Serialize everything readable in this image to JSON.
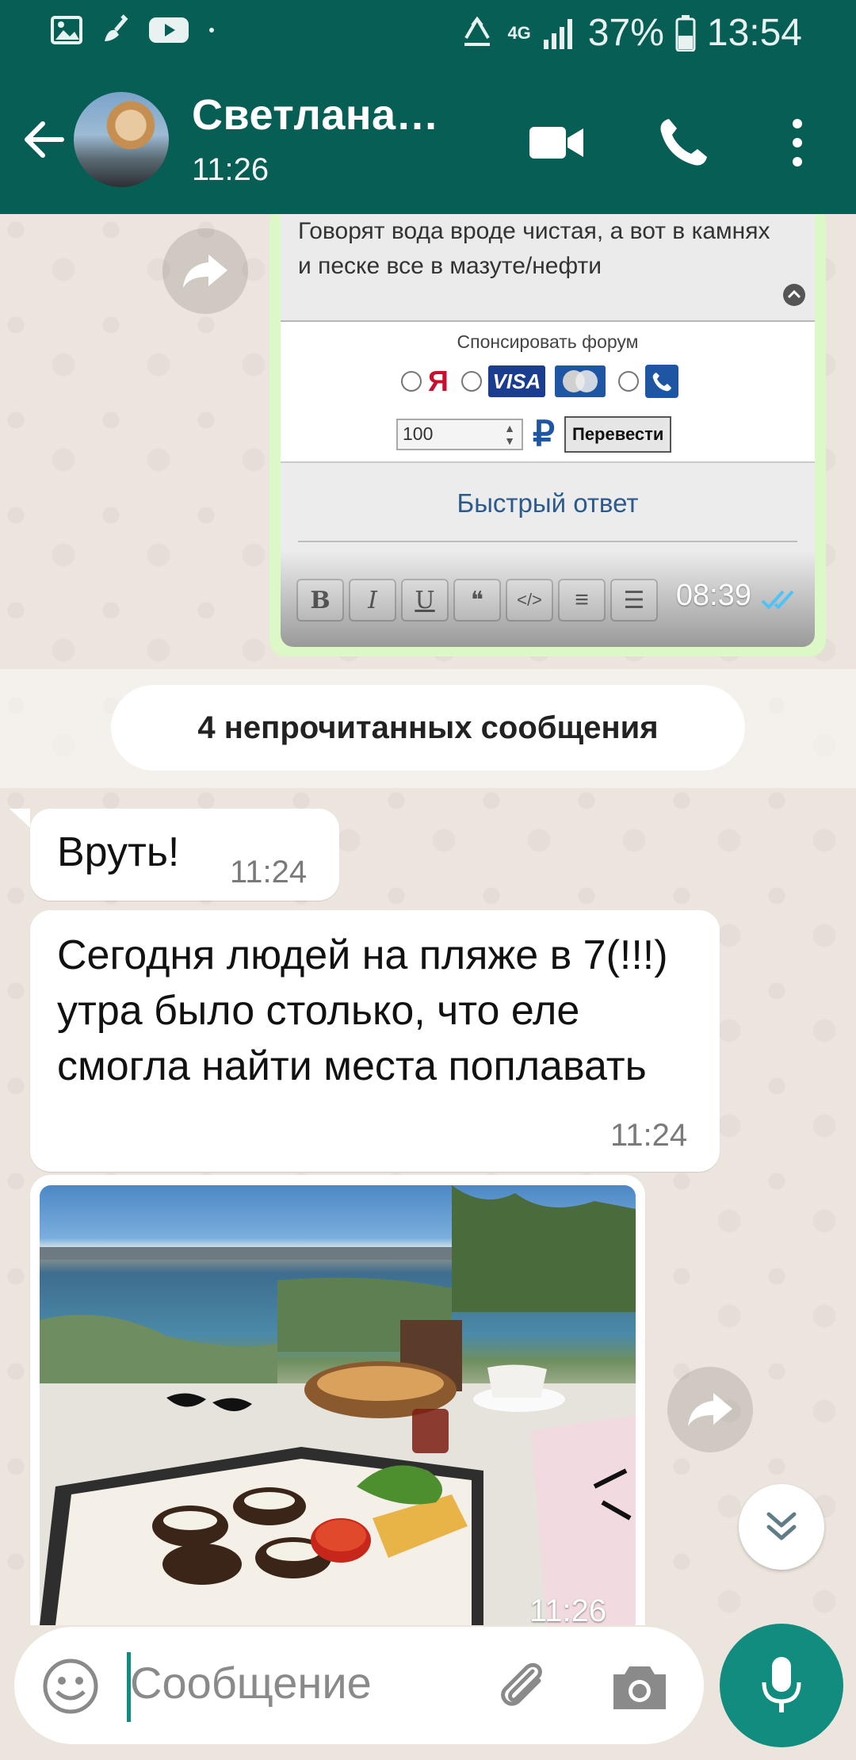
{
  "status_bar": {
    "battery": "37%",
    "time": "13:54",
    "network": "4G",
    "icons": [
      "gallery-icon",
      "cleaner-icon",
      "youtube-icon",
      "dot-icon",
      "recycle-icon",
      "signal-icon",
      "battery-icon"
    ]
  },
  "header": {
    "contact_name": "Светлана…",
    "subtitle": "11:26",
    "icons": [
      "back-arrow-icon",
      "video-call-icon",
      "voice-call-icon",
      "more-vert-icon"
    ]
  },
  "colors": {
    "header": "#075e54",
    "accent": "#128c7e",
    "outgoing_bubble": "#dcf8c6",
    "chat_bg": "#ece5dd"
  },
  "outgoing_message": {
    "screenshot": {
      "quote_text": "Говорят вода вроде чистая, а вот в камнях и песке все в мазуте/нефти",
      "sponsor_label": "Спонсировать форум",
      "payment_methods": [
        "Я",
        "VISA",
        "MasterCard",
        "phone"
      ],
      "amount_value": "100",
      "currency_symbol": "₽",
      "transfer_button": "Перевести",
      "quick_reply_title": "Быстрый ответ",
      "toolbar": [
        "B",
        "I",
        "U",
        "❝",
        "</>",
        "≡",
        "☰"
      ]
    },
    "time": "08:39",
    "read": true
  },
  "unread_banner": "4 непрочитанных сообщения",
  "incoming_messages": [
    {
      "text": "Вруть!",
      "time": "11:24"
    },
    {
      "text": "Сегодня людей на пляже в 7(!!!) утра было столько, что еле смогла найти места поплавать",
      "time": "11:24"
    },
    {
      "type": "photo",
      "time": "11:26"
    }
  ],
  "composer": {
    "placeholder": "Сообщение",
    "icons": [
      "emoji-icon",
      "attach-icon",
      "camera-icon",
      "mic-icon"
    ]
  }
}
